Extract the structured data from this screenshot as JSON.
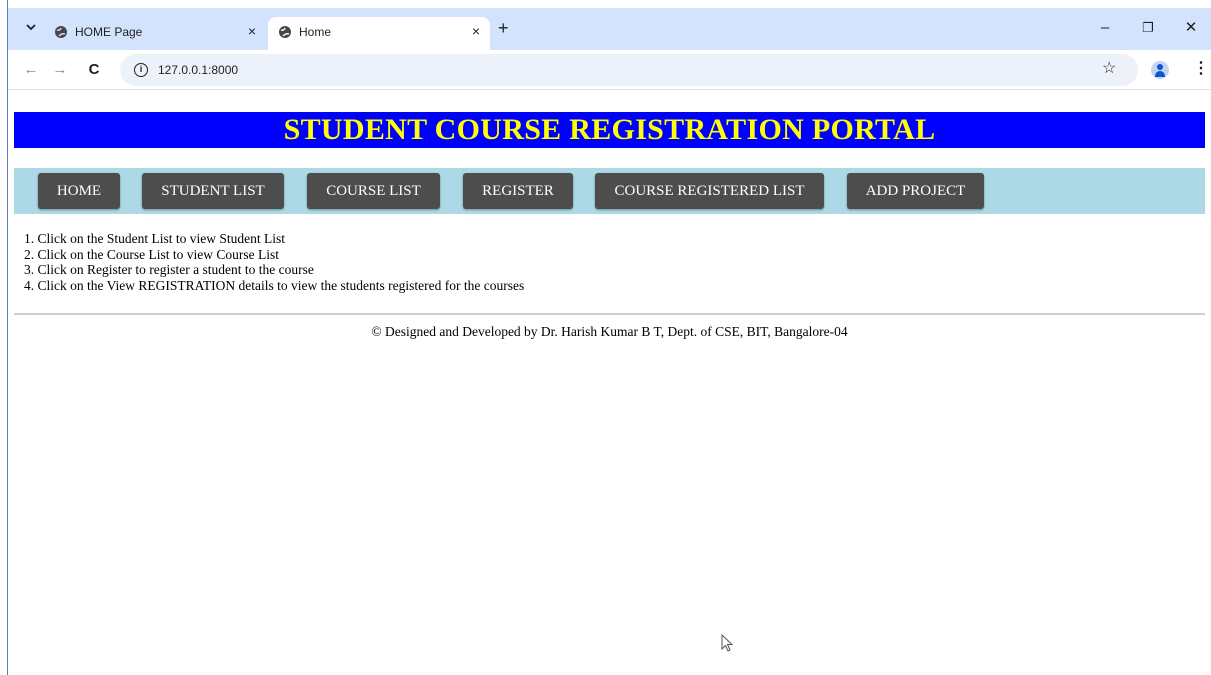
{
  "browser": {
    "tabs": [
      {
        "title": "HOME Page",
        "close": "×"
      },
      {
        "title": "Home",
        "close": "×"
      }
    ],
    "new_tab": "+",
    "tab_menu_icon": "chevron-down-icon",
    "window_controls": {
      "minimize": "–",
      "restore": "❐",
      "close": "✕"
    },
    "nav": {
      "back": "←",
      "forward": "→",
      "reload": "C"
    },
    "address_bar": {
      "url": "127.0.0.1:8000"
    },
    "star": "☆",
    "menu": "⋮"
  },
  "page": {
    "title": "STUDENT COURSE REGISTRATION PORTAL",
    "colors": {
      "banner_bg": "#0000ff",
      "banner_text": "#ffff00",
      "navbar_bg": "#add8e6",
      "nav_button_bg": "#4d4d4d"
    },
    "nav_items": [
      "HOME",
      "STUDENT LIST",
      "COURSE LIST",
      "REGISTER",
      "COURSE REGISTERED LIST",
      "ADD PROJECT"
    ],
    "instructions": [
      "1. Click on the Student List to view Student List",
      "2. Click on the Course List to view Course List",
      "3. Click on Register to register a student to the course",
      "4. Click on the View REGISTRATION details to view the students registered for the courses"
    ],
    "footer": "© Designed and Developed by Dr. Harish Kumar B T, Dept. of CSE, BIT, Bangalore-04"
  }
}
